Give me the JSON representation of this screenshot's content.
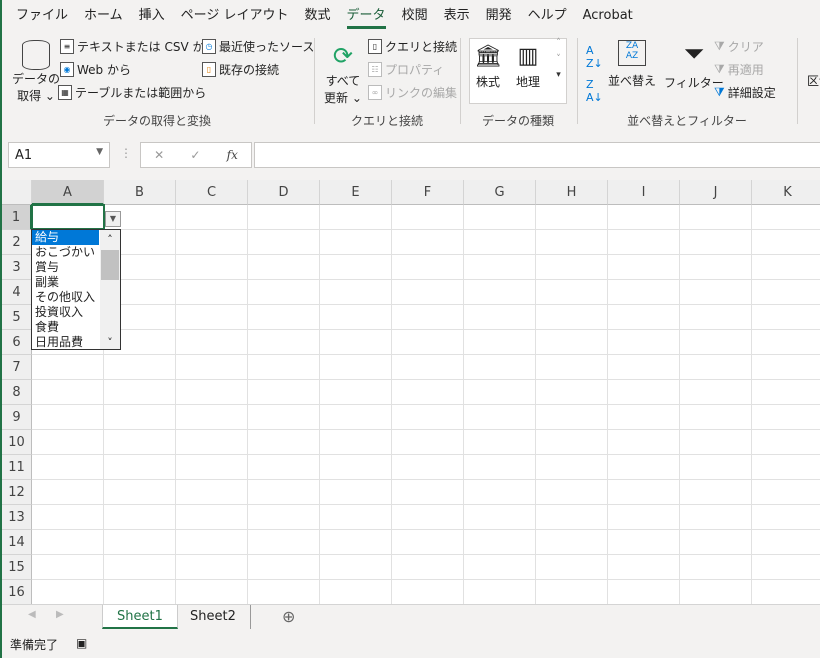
{
  "menu_tabs": [
    "ファイル",
    "ホーム",
    "挿入",
    "ページ レイアウト",
    "数式",
    "データ",
    "校閲",
    "表示",
    "開発",
    "ヘルプ",
    "Acrobat"
  ],
  "active_tab": "データ",
  "ribbon": {
    "get_data": {
      "label1": "データの",
      "label2": "取得 ⌄",
      "text_csv": "テキストまたは CSV から",
      "web": "Web から",
      "table_range": "テーブルまたは範囲から",
      "recent": "最近使ったソース",
      "existing": "既存の接続",
      "group": "データの取得と変換"
    },
    "queries": {
      "refresh1": "すべて",
      "refresh2": "更新 ⌄",
      "queries_conn": "クエリと接続",
      "properties": "プロパティ",
      "edit_links": "リンクの編集",
      "group": "クエリと接続"
    },
    "types": {
      "stocks": "株式",
      "geo": "地理",
      "group": "データの種類"
    },
    "sort": {
      "sort": "並べ替え",
      "filter": "フィルター",
      "clear": "クリア",
      "reapply": "再適用",
      "advanced": "詳細設定",
      "group": "並べ替えとフィルター"
    },
    "more": "区切"
  },
  "formula": {
    "name_box": "A1",
    "fx": "fx",
    "cancel": "✕",
    "enter": "✓",
    "value": ""
  },
  "columns": [
    "A",
    "B",
    "C",
    "D",
    "E",
    "F",
    "G",
    "H",
    "I",
    "J",
    "K"
  ],
  "rows": [
    "1",
    "2",
    "3",
    "4",
    "5",
    "6",
    "7",
    "8",
    "9",
    "10",
    "11",
    "12",
    "13",
    "14",
    "15",
    "16"
  ],
  "dropdown": {
    "items": [
      "給与",
      "おこづかい",
      "賞与",
      "副業",
      "その他収入",
      "投資収入",
      "食費",
      "日用品費"
    ],
    "selected": "給与"
  },
  "sheets": [
    "Sheet1",
    "Sheet2"
  ],
  "active_sheet": "Sheet1",
  "status": "準備完了",
  "colors": {
    "accent": "#217346",
    "selection": "#0078d7"
  }
}
